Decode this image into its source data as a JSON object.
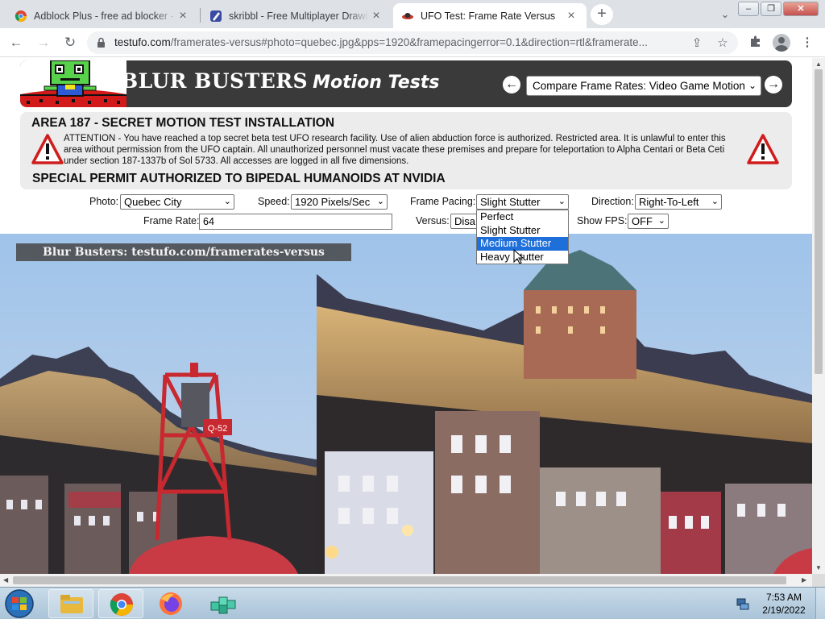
{
  "browser": {
    "tabs": [
      {
        "title": "Adblock Plus - free ad blocker - C",
        "favicon": "chrome-icon"
      },
      {
        "title": "skribbl - Free Multiplayer Drawin",
        "favicon": "skribbl-icon"
      },
      {
        "title": "UFO Test: Frame Rate Versus",
        "favicon": "ufo-icon",
        "active": true
      }
    ],
    "url_host": "testufo.com",
    "url_rest": "/framerates-versus#photo=quebec.jpg&pps=1920&framepacingerror=0.1&direction=rtl&framerate..."
  },
  "banner": {
    "brand": "BLUR BUSTERS",
    "brand_sub": "Motion Tests",
    "test_select": "Compare Frame Rates: Video Game Motion"
  },
  "warning": {
    "title": "AREA 187 - SECRET MOTION TEST INSTALLATION",
    "text": "ATTENTION - You have reached a top secret beta test UFO research facility. Use of alien abduction force is authorized. Restricted area. It is unlawful to enter this area without permission from the UFO captain. All unauthorized personnel must vacate these premises and prepare for teleportation to Alpha Centari or Beta Ceti under section 187-1337b of Sol 5733. All accesses are logged in all five dimensions.",
    "subtitle": "SPECIAL PERMIT AUTHORIZED TO BIPEDAL HUMANOIDS AT NVIDIA"
  },
  "controls": {
    "photo_label": "Photo:",
    "photo_value": "Quebec City",
    "speed_label": "Speed:",
    "speed_value": "1920 Pixels/Sec",
    "pacing_label": "Frame Pacing:",
    "pacing_value": "Slight Stutter",
    "direction_label": "Direction:",
    "direction_value": "Right-To-Left",
    "framerate_label": "Frame Rate:",
    "framerate_value": "64",
    "versus_label": "Versus:",
    "versus_value": "Disa",
    "showfps_label": "Show FPS:",
    "showfps_value": "OFF"
  },
  "pacing_options": [
    "Perfect",
    "Slight Stutter",
    "Medium Stutter",
    "Heavy Stutter"
  ],
  "pacing_highlighted": "Medium Stutter",
  "photo": {
    "watermark": "Blur Busters: testufo.com/framerates-versus",
    "buoy_label": "Q-52"
  },
  "taskbar": {
    "time": "7:53 AM",
    "date": "2/19/2022",
    "apps": [
      "file-explorer-icon",
      "chrome-icon",
      "firefox-icon",
      "app-cubes-icon"
    ]
  }
}
